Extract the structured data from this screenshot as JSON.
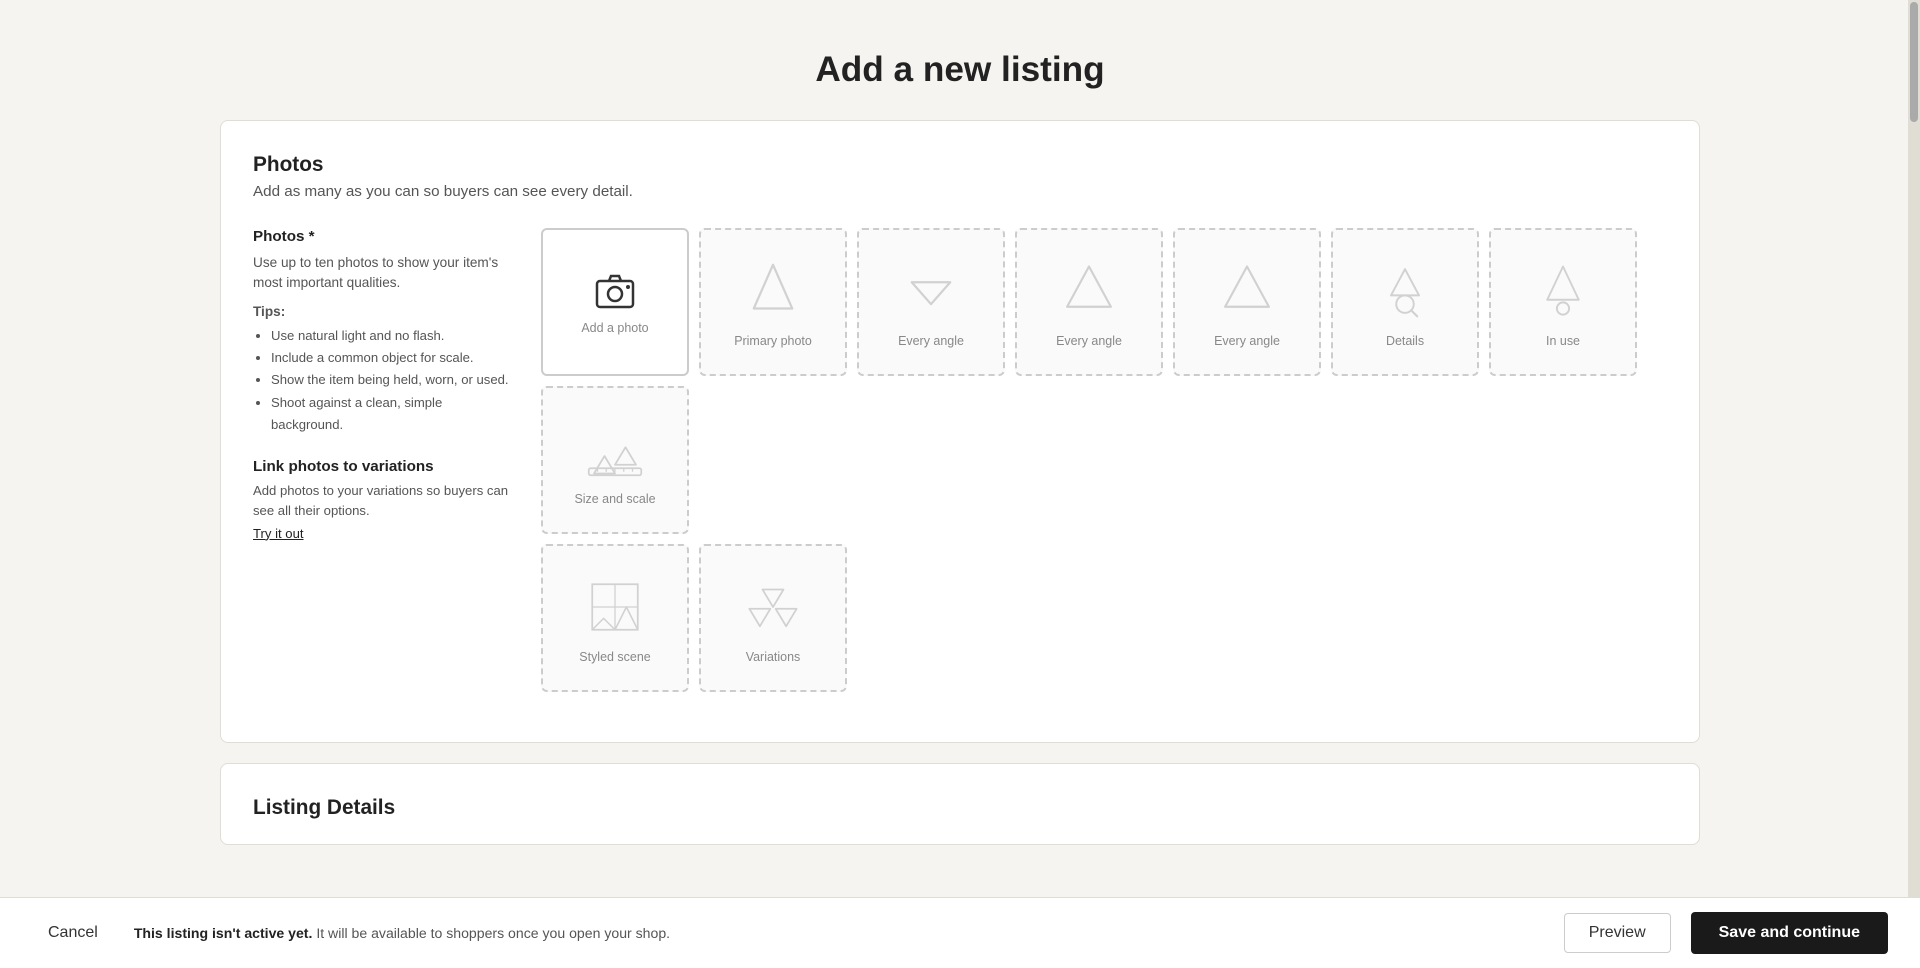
{
  "page": {
    "title": "Add a new listing"
  },
  "photos_section": {
    "title": "Photos",
    "subtitle": "Add as many as you can so buyers can see every detail.",
    "sidebar": {
      "label": "Photos *",
      "description": "Use up to ten photos to show your item's most important qualities.",
      "tips_label": "Tips:",
      "tips": [
        "Use natural light and no flash.",
        "Include a common object for scale.",
        "Show the item being held, worn, or used.",
        "Shoot against a clean, simple background."
      ],
      "link_title": "Link photos to variations",
      "link_desc": "Add photos to your variations so buyers can see all their options.",
      "try_it_out": "Try it out"
    },
    "add_photo_label": "Add a photo",
    "slots": [
      {
        "label": "Primary photo",
        "type": "primary"
      },
      {
        "label": "Every angle",
        "type": "angle"
      },
      {
        "label": "Every angle",
        "type": "angle"
      },
      {
        "label": "Every angle",
        "type": "angle"
      },
      {
        "label": "Details",
        "type": "details"
      },
      {
        "label": "In use",
        "type": "in-use"
      },
      {
        "label": "Size and scale",
        "type": "size-scale"
      },
      {
        "label": "Styled scene",
        "type": "styled-scene"
      },
      {
        "label": "Variations",
        "type": "variations"
      }
    ]
  },
  "listing_details": {
    "title": "Listing Details"
  },
  "bottom_bar": {
    "cancel_label": "Cancel",
    "notice_bold": "This listing isn't active yet.",
    "notice_text": " It will be available to shoppers once you open your shop.",
    "preview_label": "Preview",
    "save_continue_label": "Save and continue"
  }
}
